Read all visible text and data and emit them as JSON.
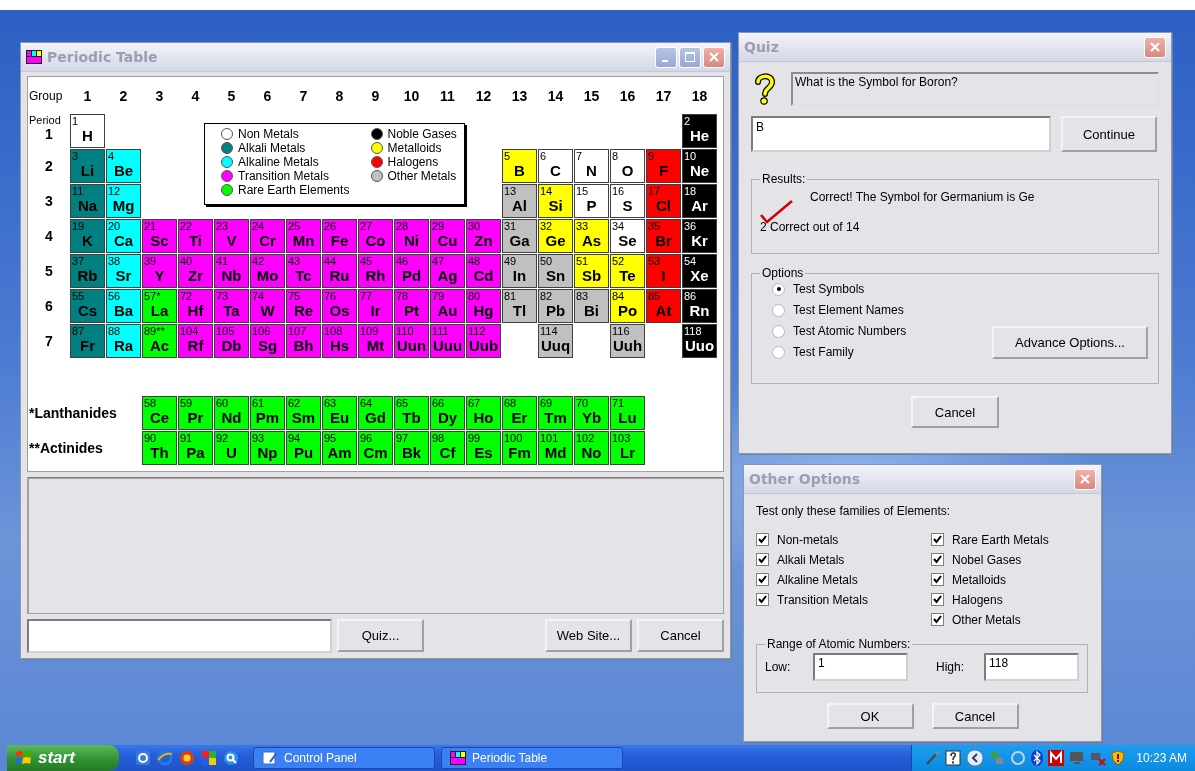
{
  "periodic_window": {
    "title": "Periodic Table",
    "group_label": "Group",
    "groups": [
      "1",
      "2",
      "3",
      "4",
      "5",
      "6",
      "7",
      "8",
      "9",
      "10",
      "11",
      "12",
      "13",
      "14",
      "15",
      "16",
      "17",
      "18"
    ],
    "period_label": "Period",
    "legend": [
      {
        "label": "Non Metals",
        "color": "#ffffff"
      },
      {
        "label": "Alkali Metals",
        "color": "#008080"
      },
      {
        "label": "Alkaline Metals",
        "color": "#00ffff"
      },
      {
        "label": "Transition Metals",
        "color": "#ff00ff"
      },
      {
        "label": "Rare Earth Elements",
        "color": "#00ff00"
      },
      {
        "label": "Noble Gases",
        "color": "#000000"
      },
      {
        "label": "Metalloids",
        "color": "#ffff00"
      },
      {
        "label": "Halogens",
        "color": "#ff0000"
      },
      {
        "label": "Other Metals",
        "color": "#c0c0c0"
      }
    ],
    "periods": [
      {
        "label": "1",
        "cells": [
          {
            "n": "1",
            "s": "H",
            "color": "#ffffff"
          },
          {
            "n": "2",
            "s": "He",
            "color": "#000000"
          }
        ]
      },
      {
        "label": "2",
        "cells": [
          {
            "n": "3",
            "s": "Li",
            "color": "#008080"
          },
          {
            "n": "4",
            "s": "Be",
            "color": "#00ffff"
          },
          {
            "n": "5",
            "s": "B",
            "color": "#ffff00"
          },
          {
            "n": "6",
            "s": "C",
            "color": "#ffffff"
          },
          {
            "n": "7",
            "s": "N",
            "color": "#ffffff"
          },
          {
            "n": "8",
            "s": "O",
            "color": "#ffffff"
          },
          {
            "n": "9",
            "s": "F",
            "color": "#ff0000"
          },
          {
            "n": "10",
            "s": "Ne",
            "color": "#000000"
          }
        ]
      },
      {
        "label": "3",
        "cells": [
          {
            "n": "11",
            "s": "Na",
            "color": "#008080"
          },
          {
            "n": "12",
            "s": "Mg",
            "color": "#00ffff"
          },
          {
            "n": "13",
            "s": "Al",
            "color": "#c0c0c0"
          },
          {
            "n": "14",
            "s": "Si",
            "color": "#ffff00"
          },
          {
            "n": "15",
            "s": "P",
            "color": "#ffffff"
          },
          {
            "n": "16",
            "s": "S",
            "color": "#ffffff"
          },
          {
            "n": "17",
            "s": "Cl",
            "color": "#ff0000"
          },
          {
            "n": "18",
            "s": "Ar",
            "color": "#000000"
          }
        ]
      },
      {
        "label": "4",
        "cells": [
          {
            "n": "19",
            "s": "K",
            "color": "#008080"
          },
          {
            "n": "20",
            "s": "Ca",
            "color": "#00ffff"
          },
          {
            "n": "21",
            "s": "Sc",
            "color": "#ff00ff"
          },
          {
            "n": "22",
            "s": "Ti",
            "color": "#ff00ff"
          },
          {
            "n": "23",
            "s": "V",
            "color": "#ff00ff"
          },
          {
            "n": "24",
            "s": "Cr",
            "color": "#ff00ff"
          },
          {
            "n": "25",
            "s": "Mn",
            "color": "#ff00ff"
          },
          {
            "n": "26",
            "s": "Fe",
            "color": "#ff00ff"
          },
          {
            "n": "27",
            "s": "Co",
            "color": "#ff00ff"
          },
          {
            "n": "28",
            "s": "Ni",
            "color": "#ff00ff"
          },
          {
            "n": "29",
            "s": "Cu",
            "color": "#ff00ff"
          },
          {
            "n": "30",
            "s": "Zn",
            "color": "#ff00ff"
          },
          {
            "n": "31",
            "s": "Ga",
            "color": "#c0c0c0"
          },
          {
            "n": "32",
            "s": "Ge",
            "color": "#ffff00"
          },
          {
            "n": "33",
            "s": "As",
            "color": "#ffff00"
          },
          {
            "n": "34",
            "s": "Se",
            "color": "#ffffff"
          },
          {
            "n": "35",
            "s": "Br",
            "color": "#ff0000"
          },
          {
            "n": "36",
            "s": "Kr",
            "color": "#000000"
          }
        ]
      },
      {
        "label": "5",
        "cells": [
          {
            "n": "37",
            "s": "Rb",
            "color": "#008080"
          },
          {
            "n": "38",
            "s": "Sr",
            "color": "#00ffff"
          },
          {
            "n": "39",
            "s": "Y",
            "color": "#ff00ff"
          },
          {
            "n": "40",
            "s": "Zr",
            "color": "#ff00ff"
          },
          {
            "n": "41",
            "s": "Nb",
            "color": "#ff00ff"
          },
          {
            "n": "42",
            "s": "Mo",
            "color": "#ff00ff"
          },
          {
            "n": "43",
            "s": "Tc",
            "color": "#ff00ff"
          },
          {
            "n": "44",
            "s": "Ru",
            "color": "#ff00ff"
          },
          {
            "n": "45",
            "s": "Rh",
            "color": "#ff00ff"
          },
          {
            "n": "46",
            "s": "Pd",
            "color": "#ff00ff"
          },
          {
            "n": "47",
            "s": "Ag",
            "color": "#ff00ff"
          },
          {
            "n": "48",
            "s": "Cd",
            "color": "#ff00ff"
          },
          {
            "n": "49",
            "s": "In",
            "color": "#c0c0c0"
          },
          {
            "n": "50",
            "s": "Sn",
            "color": "#c0c0c0"
          },
          {
            "n": "51",
            "s": "Sb",
            "color": "#ffff00"
          },
          {
            "n": "52",
            "s": "Te",
            "color": "#ffff00"
          },
          {
            "n": "53",
            "s": "I",
            "color": "#ff0000"
          },
          {
            "n": "54",
            "s": "Xe",
            "color": "#000000"
          }
        ]
      },
      {
        "label": "6",
        "cells": [
          {
            "n": "55",
            "s": "Cs",
            "color": "#008080"
          },
          {
            "n": "56",
            "s": "Ba",
            "color": "#00ffff"
          },
          {
            "n": "57*",
            "s": "La",
            "color": "#00ff00"
          },
          {
            "n": "72",
            "s": "Hf",
            "color": "#ff00ff"
          },
          {
            "n": "73",
            "s": "Ta",
            "color": "#ff00ff"
          },
          {
            "n": "74",
            "s": "W",
            "color": "#ff00ff"
          },
          {
            "n": "75",
            "s": "Re",
            "color": "#ff00ff"
          },
          {
            "n": "76",
            "s": "Os",
            "color": "#ff00ff"
          },
          {
            "n": "77",
            "s": "Ir",
            "color": "#ff00ff"
          },
          {
            "n": "78",
            "s": "Pt",
            "color": "#ff00ff"
          },
          {
            "n": "79",
            "s": "Au",
            "color": "#ff00ff"
          },
          {
            "n": "80",
            "s": "Hg",
            "color": "#ff00ff"
          },
          {
            "n": "81",
            "s": "Tl",
            "color": "#c0c0c0"
          },
          {
            "n": "82",
            "s": "Pb",
            "color": "#c0c0c0"
          },
          {
            "n": "83",
            "s": "Bi",
            "color": "#c0c0c0"
          },
          {
            "n": "84",
            "s": "Po",
            "color": "#ffff00"
          },
          {
            "n": "85",
            "s": "At",
            "color": "#ff0000"
          },
          {
            "n": "86",
            "s": "Rn",
            "color": "#000000"
          }
        ]
      },
      {
        "label": "7",
        "cells": [
          {
            "n": "87",
            "s": "Fr",
            "color": "#008080"
          },
          {
            "n": "88",
            "s": "Ra",
            "color": "#00ffff"
          },
          {
            "n": "89**",
            "s": "Ac",
            "color": "#00ff00"
          },
          {
            "n": "104",
            "s": "Rf",
            "color": "#ff00ff"
          },
          {
            "n": "105",
            "s": "Db",
            "color": "#ff00ff"
          },
          {
            "n": "106",
            "s": "Sg",
            "color": "#ff00ff"
          },
          {
            "n": "107",
            "s": "Bh",
            "color": "#ff00ff"
          },
          {
            "n": "108",
            "s": "Hs",
            "color": "#ff00ff"
          },
          {
            "n": "109",
            "s": "Mt",
            "color": "#ff00ff"
          },
          {
            "n": "110",
            "s": "Uun",
            "color": "#ff00ff"
          },
          {
            "n": "111",
            "s": "Uuu",
            "color": "#ff00ff"
          },
          {
            "n": "112",
            "s": "Uub",
            "color": "#ff00ff"
          },
          {
            "n": "114",
            "s": "Uuq",
            "color": "#c0c0c0"
          },
          {
            "n": "116",
            "s": "Uuh",
            "color": "#c0c0c0"
          },
          {
            "n": "118",
            "s": "Uuo",
            "color": "#000000"
          }
        ]
      }
    ],
    "f_rows": [
      {
        "label": "*Lanthanides",
        "cells": [
          {
            "n": "58",
            "s": "Ce",
            "color": "#00ff00"
          },
          {
            "n": "59",
            "s": "Pr",
            "color": "#00ff00"
          },
          {
            "n": "60",
            "s": "Nd",
            "color": "#00ff00"
          },
          {
            "n": "61",
            "s": "Pm",
            "color": "#00ff00"
          },
          {
            "n": "62",
            "s": "Sm",
            "color": "#00ff00"
          },
          {
            "n": "63",
            "s": "Eu",
            "color": "#00ff00"
          },
          {
            "n": "64",
            "s": "Gd",
            "color": "#00ff00"
          },
          {
            "n": "65",
            "s": "Tb",
            "color": "#00ff00"
          },
          {
            "n": "66",
            "s": "Dy",
            "color": "#00ff00"
          },
          {
            "n": "67",
            "s": "Ho",
            "color": "#00ff00"
          },
          {
            "n": "68",
            "s": "Er",
            "color": "#00ff00"
          },
          {
            "n": "69",
            "s": "Tm",
            "color": "#00ff00"
          },
          {
            "n": "70",
            "s": "Yb",
            "color": "#00ff00"
          },
          {
            "n": "71",
            "s": "Lu",
            "color": "#00ff00"
          }
        ]
      },
      {
        "label": "**Actinides",
        "cells": [
          {
            "n": "90",
            "s": "Th",
            "color": "#00ff00"
          },
          {
            "n": "91",
            "s": "Pa",
            "color": "#00ff00"
          },
          {
            "n": "92",
            "s": "U",
            "color": "#00ff00"
          },
          {
            "n": "93",
            "s": "Np",
            "color": "#00ff00"
          },
          {
            "n": "94",
            "s": "Pu",
            "color": "#00ff00"
          },
          {
            "n": "95",
            "s": "Am",
            "color": "#00ff00"
          },
          {
            "n": "96",
            "s": "Cm",
            "color": "#00ff00"
          },
          {
            "n": "97",
            "s": "Bk",
            "color": "#00ff00"
          },
          {
            "n": "98",
            "s": "Cf",
            "color": "#00ff00"
          },
          {
            "n": "99",
            "s": "Es",
            "color": "#00ff00"
          },
          {
            "n": "100",
            "s": "Fm",
            "color": "#00ff00"
          },
          {
            "n": "101",
            "s": "Md",
            "color": "#00ff00"
          },
          {
            "n": "102",
            "s": "No",
            "color": "#00ff00"
          },
          {
            "n": "103",
            "s": "Lr",
            "color": "#00ff00"
          }
        ]
      }
    ],
    "buttons": [
      "Quiz...",
      "Web Site...",
      "Cancel"
    ]
  },
  "quiz": {
    "title": "Quiz",
    "question": "What is the Symbol for Boron?",
    "answer": "B",
    "continue": "Continue",
    "results_label": "Results:",
    "result": "Correct! The Symbol for Germanium is Ge",
    "score": "2 Correct out of 14",
    "options_label": "Options",
    "options": [
      {
        "label": "Test Symbols",
        "selected": true
      },
      {
        "label": "Test Element Names",
        "selected": false
      },
      {
        "label": "Test Atomic Numbers",
        "selected": false
      },
      {
        "label": "Test Family",
        "selected": false
      }
    ],
    "advance": "Advance Options...",
    "cancel": "Cancel"
  },
  "other_options": {
    "title": "Other Options",
    "prompt": "Test only these families of Elements:",
    "families_left": [
      {
        "label": "Non-metals",
        "checked": true
      },
      {
        "label": "Alkali Metals",
        "checked": true
      },
      {
        "label": "Alkaline Metals",
        "checked": true
      },
      {
        "label": "Transition Metals",
        "checked": true
      }
    ],
    "families_right": [
      {
        "label": "Rare Earth Metals",
        "checked": true
      },
      {
        "label": "Nobel Gases",
        "checked": true
      },
      {
        "label": "Metalloids",
        "checked": true
      },
      {
        "label": "Halogens",
        "checked": true
      },
      {
        "label": "Other Metals",
        "checked": true
      }
    ],
    "range_label": "Range of Atomic Numbers:",
    "low_label": "Low:",
    "low": "1",
    "high_label": "High:",
    "high": "118",
    "ok": "OK",
    "cancel": "Cancel"
  },
  "taskbar": {
    "start": "start",
    "tasks": [
      {
        "label": "Control Panel",
        "selected": false
      },
      {
        "label": "Periodic Table",
        "selected": false
      }
    ],
    "clock": "10:23 AM"
  }
}
